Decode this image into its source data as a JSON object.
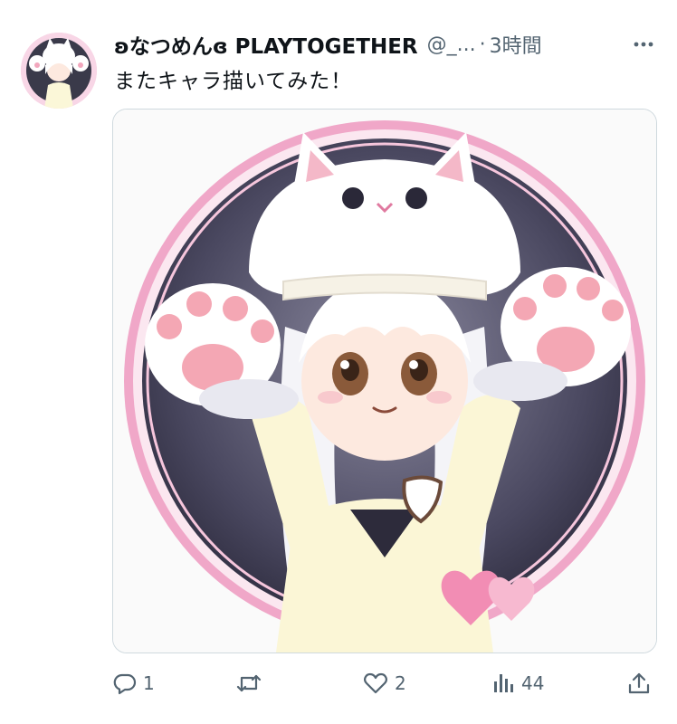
{
  "tweet": {
    "display_name": "ʚなつめんɞ PLAYTOGETHER",
    "handle": "@_...",
    "separator": "·",
    "time": "3時間",
    "text": "またキャラ描いてみた！"
  },
  "actions": {
    "reply_count": "1",
    "retweet_count": "",
    "like_count": "2",
    "views_count": "44"
  },
  "icons": [
    "more-icon",
    "reply-icon",
    "retweet-icon",
    "like-icon",
    "views-icon",
    "share-icon"
  ],
  "colors": {
    "text": "#0f1419",
    "secondary": "#536471",
    "border": "#cfd9de",
    "pink_ring": "#f0a7c8"
  }
}
